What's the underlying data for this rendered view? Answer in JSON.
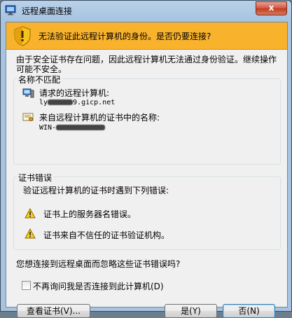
{
  "window": {
    "title": "远程桌面连接",
    "close_glyph": "x"
  },
  "banner": {
    "text": "无法验证此远程计算机的身份。是否仍要连接?"
  },
  "intro": "由于安全证书存在问题，因此远程计算机无法通过身份验证。继续操作可能不安全。",
  "name_mismatch": {
    "legend": "名称不匹配",
    "requested_label": "请求的远程计算机:",
    "requested_value_prefix": "ly",
    "requested_value_suffix": "9.gicp.net",
    "cert_label": "来自远程计算机的证书中的名称:",
    "cert_value_prefix": "WIN-"
  },
  "cert_errors": {
    "legend": "证书错误",
    "description": "验证远程计算机的证书时遇到下列错误:",
    "errors": [
      "证书上的服务器名错误。",
      "证书来自不信任的证书验证机构。"
    ]
  },
  "question": "您想连接到远程桌面而忽略这些证书错误吗?",
  "checkbox_label": "不再询问我是否连接到此计算机(D)",
  "buttons": {
    "view_cert": "查看证书(V)...",
    "yes": "是(Y)",
    "no": "否(N)"
  },
  "colors": {
    "banner": "#f8b22c",
    "titlebar": "#b9d1ea",
    "close": "#c23b22"
  }
}
